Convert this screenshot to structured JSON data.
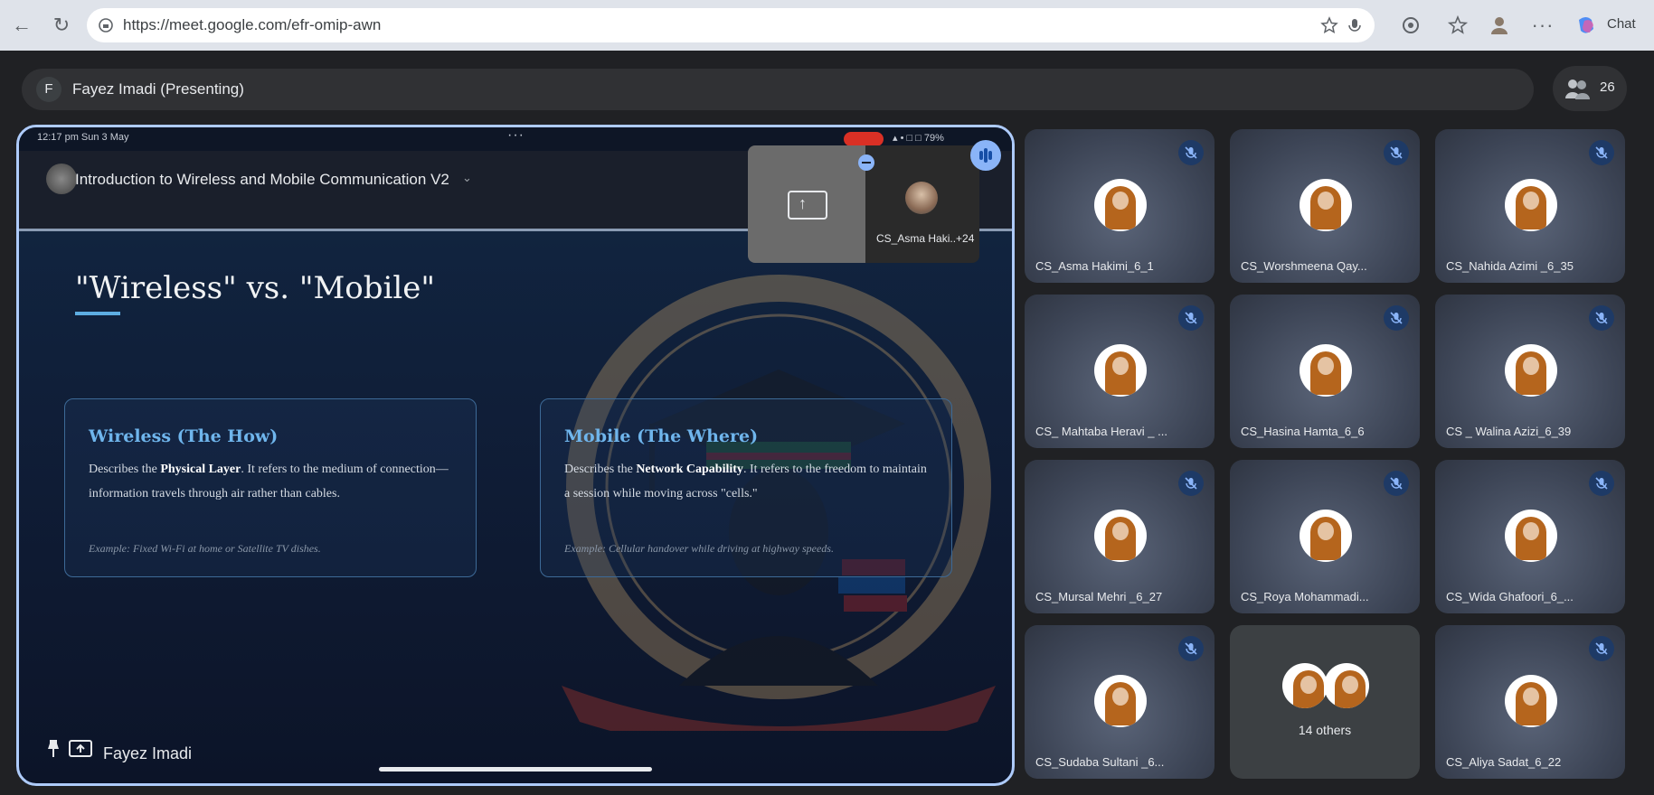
{
  "browser": {
    "url": "https://meet.google.com/efr-omip-awn",
    "chat_label": "Chat"
  },
  "meet": {
    "presenter_initial": "F",
    "presenter_label": "Fayez Imadi (Presenting)",
    "participant_count": "26",
    "presentation": {
      "status_time": "12:17 pm   Sun 3 May",
      "status_right": "▴ • □ □ 79%",
      "doc_title": "Introduction to Wireless and Mobile Communication V2",
      "pip_label": "CS_Asma Haki..+24",
      "slide_heading": "\"Wireless\" vs. \"Mobile\"",
      "cards": [
        {
          "title": "Wireless (The How)",
          "body_pre": "Describes the ",
          "body_bold": "Physical Layer",
          "body_post": ". It refers to the medium of connection—information travels through air rather than cables.",
          "example": "Example: Fixed Wi-Fi at home or Satellite TV dishes."
        },
        {
          "title": "Mobile (The Where)",
          "body_pre": "Describes the ",
          "body_bold": "Network Capability",
          "body_post": ". It refers to the freedom to maintain a session while moving across \"cells.\"",
          "example": "Example: Cellular handover while driving at highway speeds."
        }
      ],
      "owner_name": "Fayez Imadi"
    },
    "participants": [
      {
        "name": "CS_Asma Hakimi_6_1"
      },
      {
        "name": "CS_Worshmeena Qay..."
      },
      {
        "name": "CS_Nahida Azimi _6_35"
      },
      {
        "name": "CS_ Mahtaba Heravi _ ..."
      },
      {
        "name": "CS_Hasina Hamta_6_6"
      },
      {
        "name": "CS _ Walina Azizi_6_39"
      },
      {
        "name": "CS_Mursal Mehri _6_27"
      },
      {
        "name": "CS_Roya Mohammadi..."
      },
      {
        "name": "CS_Wida Ghafoori_6_..."
      },
      {
        "name": "CS_Sudaba Sultani _6..."
      },
      {
        "name": "14 others"
      },
      {
        "name": "CS_Aliya Sadat_6_22"
      }
    ]
  }
}
